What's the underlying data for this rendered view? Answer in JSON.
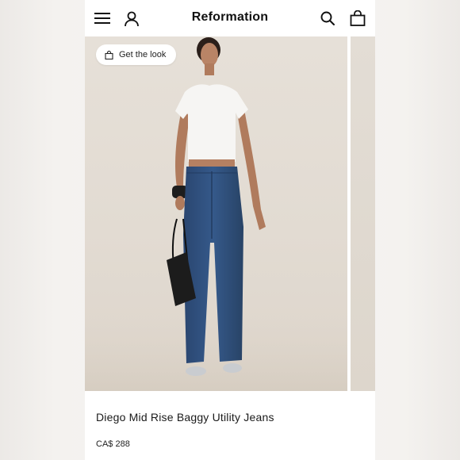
{
  "header": {
    "brand": "Reformation",
    "icons": [
      "menu-icon",
      "account-icon",
      "search-icon",
      "shopping-bag-icon"
    ]
  },
  "gallery": {
    "get_the_look_label": "Get the look"
  },
  "product": {
    "name": "Diego Mid Rise Baggy Utility Jeans",
    "price": "CA$ 288"
  },
  "colors": {
    "background": "#f4f2ef",
    "photo_backdrop": "#e2dbd2",
    "denim": "#2f4e7a",
    "text": "#111111"
  }
}
